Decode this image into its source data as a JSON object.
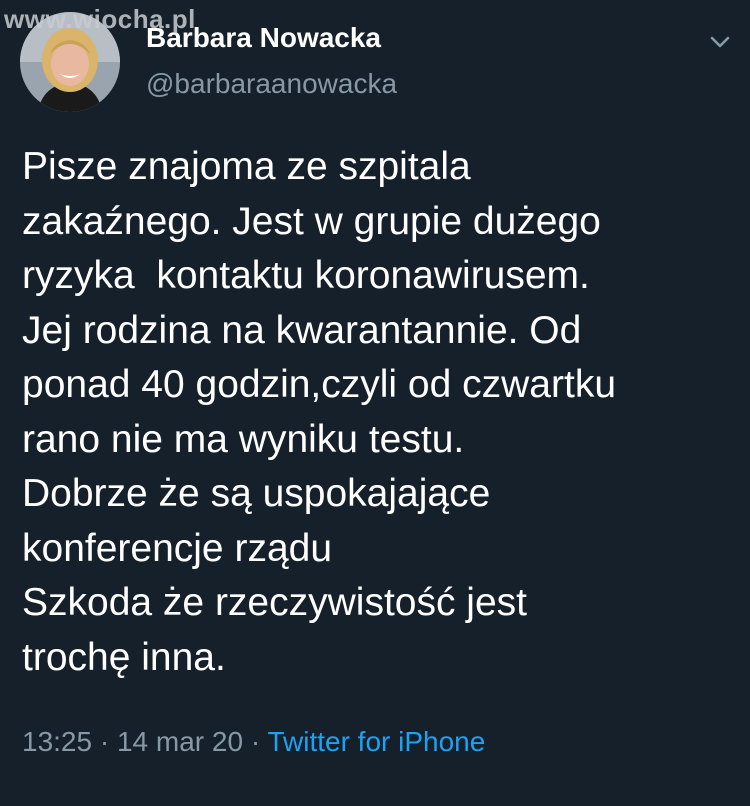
{
  "watermark": "www.wiocha.pl",
  "author": {
    "display_name": "Barbara Nowacka",
    "handle": "@barbaraanowacka"
  },
  "menu_icon": "chevron-down-icon",
  "tweet": {
    "lines": [
      "Pisze znajoma ze szpitala",
      "zakaźnego. Jest w grupie dużego",
      "ryzyka  kontaktu koronawirusem.",
      "Jej rodzina na kwarantannie. Od",
      "ponad 40 godzin,czyli od czwartku",
      "rano nie ma wyniku testu.",
      "Dobrze że są uspokajające",
      "konferencje rządu",
      "Szkoda że rzeczywistość jest",
      "trochę inna."
    ]
  },
  "meta": {
    "time": "13:25",
    "separator": " · ",
    "date": "14 mar 20",
    "source": "Twitter for iPhone"
  },
  "colors": {
    "background": "#15202b",
    "text": "#ffffff",
    "secondary": "#8899a6",
    "link": "#1da1f2"
  }
}
